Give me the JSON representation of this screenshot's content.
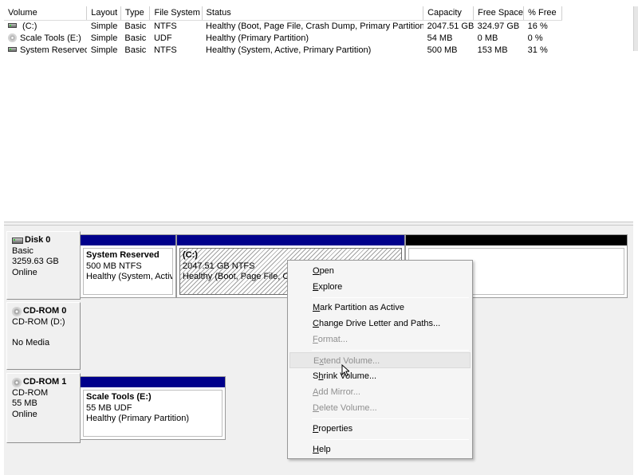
{
  "volume_list": {
    "columns": [
      "Volume",
      "Layout",
      "Type",
      "File System",
      "Status",
      "Capacity",
      "Free Space",
      "% Free"
    ],
    "rows": [
      {
        "icon": "hard-drive-icon",
        "volume": " (C:)",
        "layout": "Simple",
        "type": "Basic",
        "fs": "NTFS",
        "status": "Healthy (Boot, Page File, Crash Dump, Primary Partition)",
        "capacity": "2047.51 GB",
        "free": "324.97 GB",
        "pct": "16 %"
      },
      {
        "icon": "cd-icon",
        "volume": "Scale Tools (E:)",
        "layout": "Simple",
        "type": "Basic",
        "fs": "UDF",
        "status": "Healthy (Primary Partition)",
        "capacity": "54 MB",
        "free": "0 MB",
        "pct": "0 %"
      },
      {
        "icon": "hard-drive-icon",
        "volume": "System Reserved",
        "layout": "Simple",
        "type": "Basic",
        "fs": "NTFS",
        "status": "Healthy (System, Active, Primary Partition)",
        "capacity": "500 MB",
        "free": "153 MB",
        "pct": "31 %"
      }
    ]
  },
  "disks": [
    {
      "name": "Disk 0",
      "kind": "Basic",
      "size": "3259.63 GB",
      "state": "Online",
      "partitions": [
        {
          "name": "System Reserved",
          "line2": "500 MB NTFS",
          "line3": "Healthy (System, Activ"
        },
        {
          "name": " (C:)",
          "line2": "2047.51 GB NTFS",
          "line3": "Healthy (Boot, Page File, Cra"
        }
      ]
    },
    {
      "name": "CD-ROM 0",
      "kind": "CD-ROM (D:)",
      "size": "",
      "state": "No Media"
    },
    {
      "name": "CD-ROM 1",
      "kind": "CD-ROM",
      "size": "55 MB",
      "state": "Online",
      "partitions": [
        {
          "name": "Scale Tools  (E:)",
          "line2": "55 MB UDF",
          "line3": "Healthy (Primary Partition)"
        }
      ]
    }
  ],
  "context_menu": {
    "items": [
      {
        "label": "Open",
        "mnemonic": "O",
        "rest": "pen",
        "enabled": true
      },
      {
        "label": "Explore",
        "mnemonic": "E",
        "rest": "xplore",
        "enabled": true
      },
      {
        "label": "Mark Partition as Active",
        "mnemonic": "M",
        "rest": "ark Partition as Active",
        "enabled": true
      },
      {
        "label": "Change Drive Letter and Paths...",
        "mnemonic": "C",
        "rest": "hange Drive Letter and Paths...",
        "enabled": true
      },
      {
        "label": "Format...",
        "mnemonic": "F",
        "rest": "ormat...",
        "enabled": false
      },
      {
        "label": "Extend Volume...",
        "mnemonic": "x",
        "pre": "E",
        "rest": "tend Volume...",
        "enabled": false
      },
      {
        "label": "Shrink Volume...",
        "mnemonic": "h",
        "pre": "S",
        "rest": "rink Volume...",
        "enabled": true
      },
      {
        "label": "Add Mirror...",
        "mnemonic": "A",
        "rest": "dd Mirror...",
        "enabled": false
      },
      {
        "label": "Delete Volume...",
        "mnemonic": "D",
        "rest": "elete Volume...",
        "enabled": false
      },
      {
        "label": "Properties",
        "mnemonic": "P",
        "rest": "roperties",
        "enabled": true
      },
      {
        "label": "Help",
        "mnemonic": "H",
        "rest": "elp",
        "enabled": true
      }
    ]
  },
  "colors": {
    "primary_partition_bar": "#00008b",
    "unallocated_bar": "#000000",
    "disabled_text": "#8f8f8f"
  }
}
